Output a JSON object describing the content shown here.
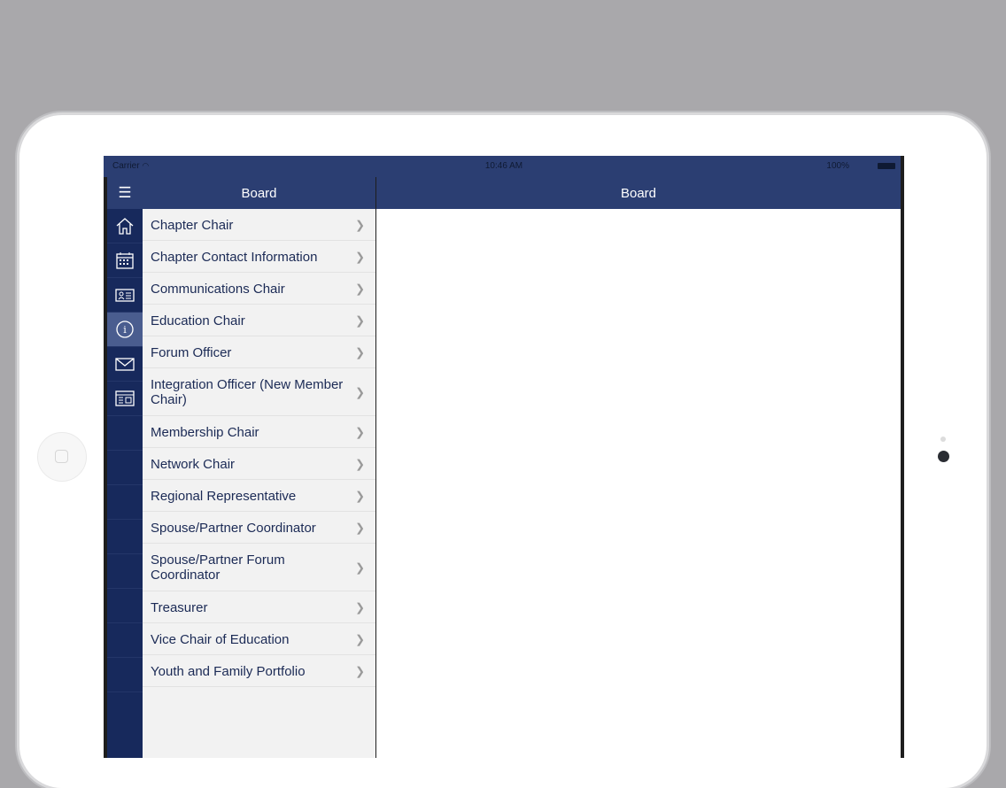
{
  "statusbar": {
    "carrier": "Carrier",
    "time": "10:46 AM",
    "battery": "100%"
  },
  "rail": {
    "menu_icon": "hamburger-icon",
    "items": [
      {
        "icon": "home-icon"
      },
      {
        "icon": "calendar-icon"
      },
      {
        "icon": "contact-card-icon"
      },
      {
        "icon": "info-icon",
        "selected": true
      },
      {
        "icon": "mail-icon"
      },
      {
        "icon": "browser-icon"
      }
    ]
  },
  "master": {
    "title": "Board",
    "items": [
      {
        "label": "Chapter Chair"
      },
      {
        "label": "Chapter Contact Information"
      },
      {
        "label": "Communications Chair"
      },
      {
        "label": "Education Chair"
      },
      {
        "label": "Forum Officer"
      },
      {
        "label": "Integration Officer (New Member Chair)"
      },
      {
        "label": "Membership Chair"
      },
      {
        "label": "Network Chair"
      },
      {
        "label": "Regional Representative"
      },
      {
        "label": "Spouse/Partner Coordinator"
      },
      {
        "label": "Spouse/Partner Forum Coordinator"
      },
      {
        "label": "Treasurer"
      },
      {
        "label": "Vice Chair of Education"
      },
      {
        "label": "Youth and Family Portfolio"
      }
    ]
  },
  "detail": {
    "title": "Board"
  },
  "colors": {
    "navbar": "#2b3e72",
    "rail": "#17295c",
    "text": "#1b2a55",
    "background": "#a9a8ab"
  }
}
